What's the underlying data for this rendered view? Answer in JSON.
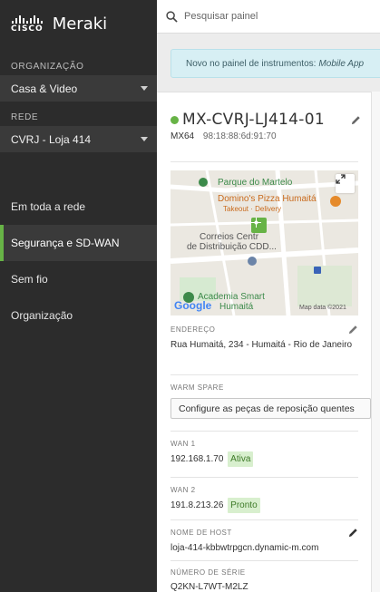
{
  "brand": {
    "cisco": "CISCO",
    "product": "Meraki"
  },
  "sidebar": {
    "org_label": "ORGANIZAÇÃO",
    "org_value": "Casa & Video",
    "network_label": "REDE",
    "network_value": "CVRJ - Loja 414",
    "nav": [
      {
        "label": "Em toda a rede",
        "active": false
      },
      {
        "label": "Segurança e SD-WAN",
        "active": true
      },
      {
        "label": "Sem fio",
        "active": false
      },
      {
        "label": "Organização",
        "active": false
      }
    ]
  },
  "search": {
    "placeholder": "Pesquisar painel"
  },
  "banner": {
    "text": "Novo no painel de instrumentos:",
    "link": "Mobile App"
  },
  "device": {
    "name": "MX-CVRJ-LJ414-01",
    "model": "MX64",
    "mac": "98:18:88:6d:91:70",
    "status_color": "#67b346"
  },
  "map": {
    "poi_park": "Parque do Martelo",
    "poi_dominos": "Domino's Pizza Humaitá",
    "poi_dominos_sub": "Takeout · Delivery",
    "poi_correios_1": "Correios Centr",
    "poi_correios_2": "de Distribuição CDD...",
    "poi_academia": "Academia Smart",
    "poi_humaita": "Humaitá",
    "google": "Google",
    "copyright": "Map data ©2021",
    "expand_icon": "expand-icon"
  },
  "fields": {
    "address_label": "ENDEREÇO",
    "address_value": "Rua Humaitá, 234 - Humaitá - Rio de Janeiro",
    "warm_label": "WARM SPARE",
    "warm_button": "Configure as peças de reposição quentes",
    "wan1_label": "WAN 1",
    "wan1_ip": "192.168.1.70",
    "wan1_status": "Ativa",
    "wan2_label": "WAN 2",
    "wan2_ip": "191.8.213.26",
    "wan2_status": "Pronto",
    "host_label": "NOME DE HOST",
    "host_value": "loja-414-kbbwtrpgcn.dynamic-m.com",
    "serial_label": "NÚMERO DE SÉRIE",
    "serial_value": "Q2KN-L7WT-M2LZ"
  },
  "colors": {
    "accent": "#67b346",
    "sidebar_bg": "#2c2c2c",
    "banner_bg": "#d7eff4"
  }
}
